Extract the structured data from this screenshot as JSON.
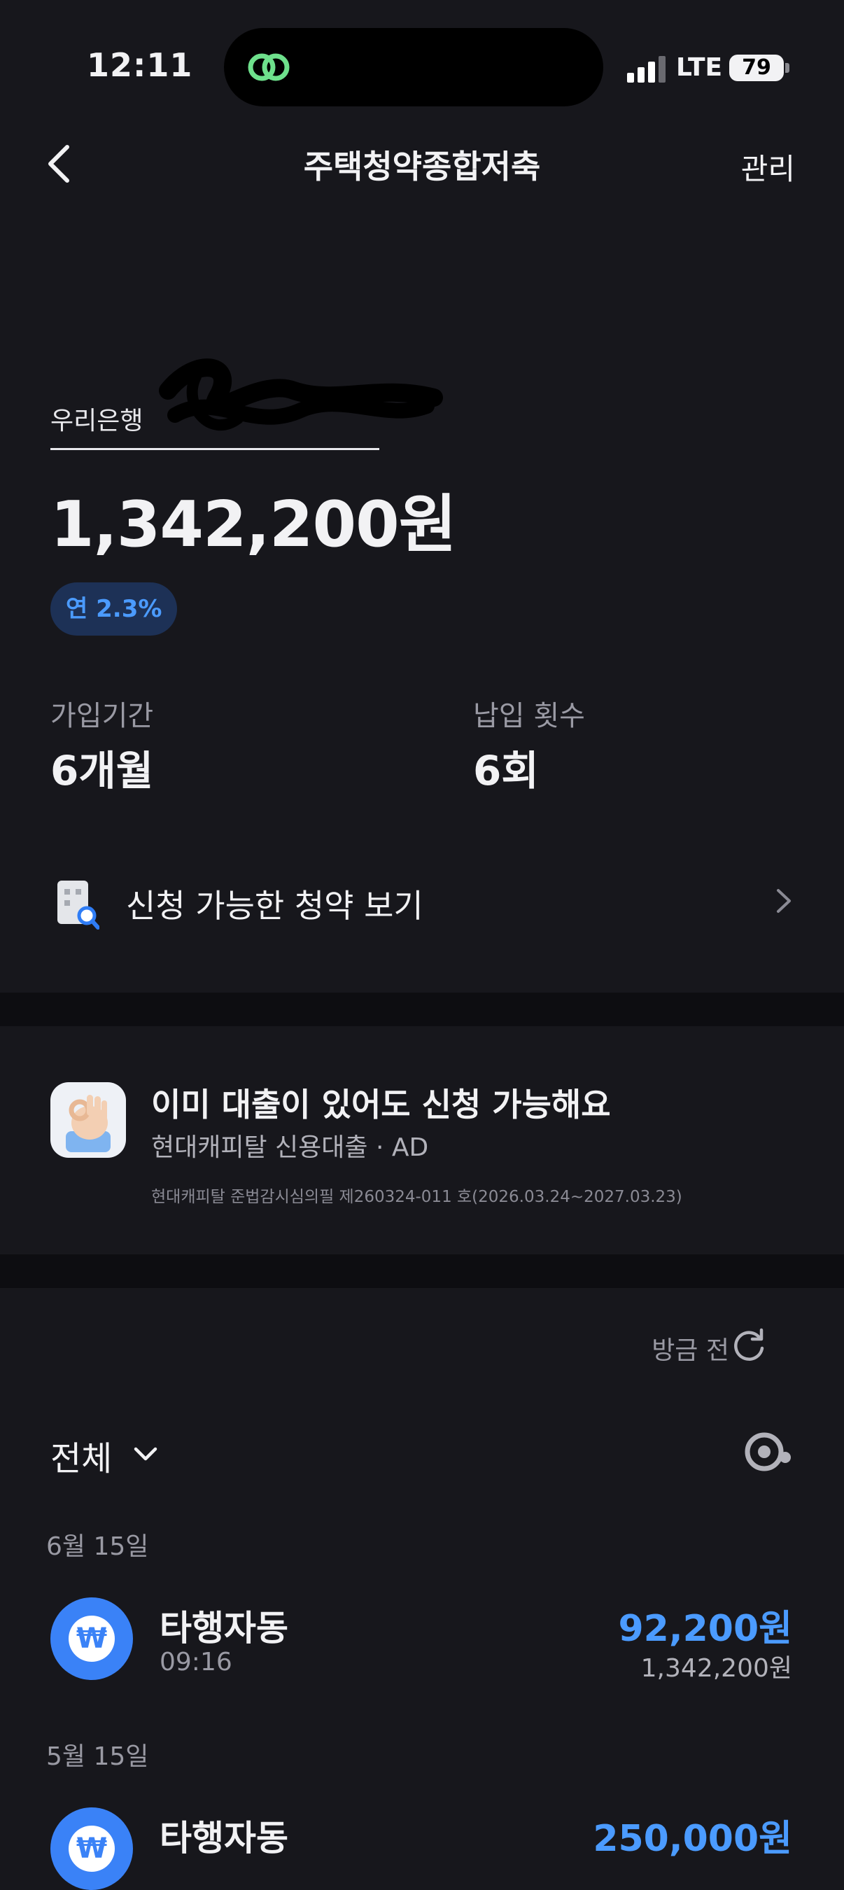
{
  "status_bar": {
    "time": "12:11",
    "network": "LTE",
    "battery": "79"
  },
  "nav": {
    "title": "주택청약종합저축",
    "manage_label": "관리"
  },
  "account": {
    "bank": "우리은행",
    "balance": "1,342,200원",
    "rate_badge": "연 2.3%"
  },
  "stats": {
    "period_label": "가입기간",
    "period_value": "6개월",
    "count_label": "납입 횟수",
    "count_value": "6회"
  },
  "apply": {
    "label": "신청 가능한 청약 보기"
  },
  "ad": {
    "title": "이미 대출이 있어도 신청 가능해요",
    "subtitle": "현대캐피탈 신용대출 · AD",
    "notice": "현대캐피탈 준법감시심의필 제260324-011 호(2026.03.24~2027.03.23)"
  },
  "transactions": {
    "updated": "방금 전",
    "filter_label": "전체",
    "groups": [
      {
        "date": "6월 15일",
        "items": [
          {
            "title": "타행자동",
            "time": "09:16",
            "amount": "92,200원",
            "balance": "1,342,200원"
          }
        ]
      },
      {
        "date": "5월 15일",
        "items": [
          {
            "title": "타행자동",
            "amount": "250,000원"
          }
        ]
      }
    ]
  },
  "icons": {
    "island": "link-rings-icon",
    "back": "chevron-left-icon",
    "apply": "building-search-icon",
    "ad": "ok-hand-icon",
    "refresh": "refresh-icon",
    "filter": "chevron-down-icon",
    "search": "search-icon",
    "transfer": "won-icon"
  },
  "colors": {
    "accent": "#4b9bff",
    "background": "#17171c",
    "badge_bg": "#1d3156"
  }
}
